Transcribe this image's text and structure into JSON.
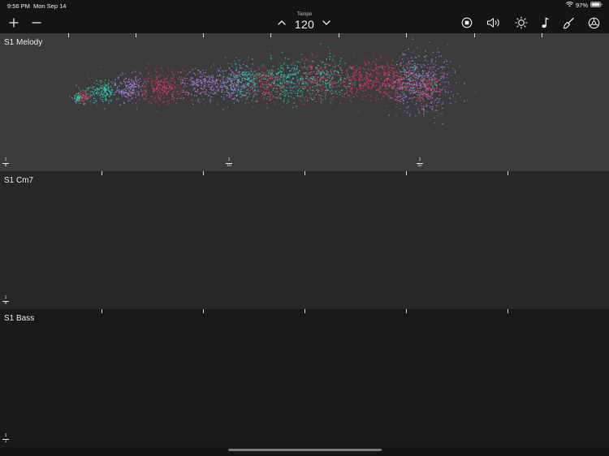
{
  "status_bar": {
    "time": "9:56 PM",
    "date": "Mon Sep 14",
    "battery": "97%",
    "icons": [
      "wifi-icon",
      "battery-icon"
    ]
  },
  "toolbar": {
    "add_icon": "plus-icon",
    "remove_icon": "minus-icon",
    "tempo": {
      "label": "Tempo",
      "value": "120",
      "up_icon": "chevron-up-icon",
      "down_icon": "chevron-down-icon"
    },
    "right_icons": [
      "record-stop-icon",
      "speaker-icon",
      "brightness-icon",
      "music-note-icon",
      "brush-icon",
      "settings-icon"
    ]
  },
  "tracks": [
    {
      "name": "S1 Melody",
      "background": "#3b3b3b",
      "divisions": [
        {
          "numerator": "1",
          "denominator": "8"
        },
        {
          "numerator": "1",
          "denominator": "16"
        },
        {
          "numerator": "1",
          "denominator": "32"
        }
      ]
    },
    {
      "name": "S1 Cm7",
      "background": "#272727",
      "divisions": [
        {
          "numerator": "1",
          "denominator": "4"
        }
      ]
    },
    {
      "name": "S1 Bass",
      "background": "#191919",
      "divisions": [
        {
          "numerator": "1",
          "denominator": "1"
        }
      ]
    }
  ],
  "particle_colors": {
    "teal": "#2fd6b4",
    "pink": "#f0366e",
    "lavender": "#b48cf5"
  }
}
